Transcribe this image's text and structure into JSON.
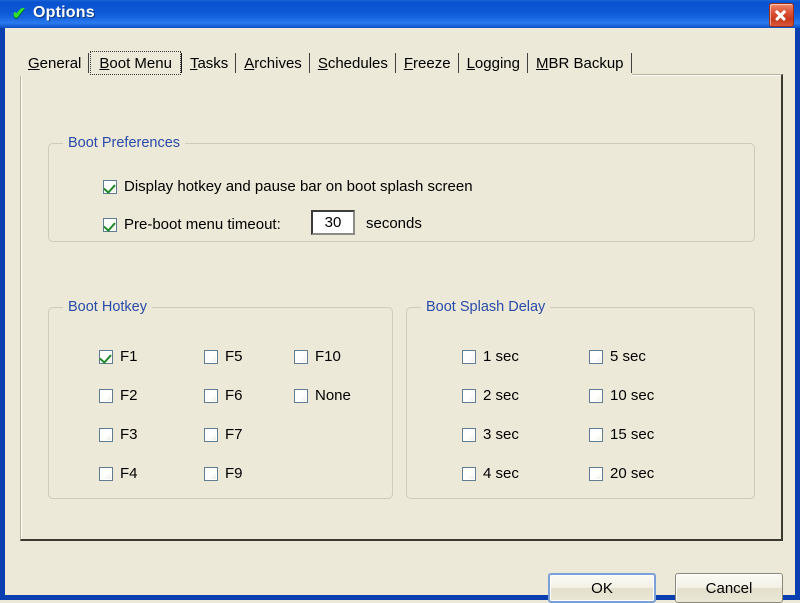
{
  "window": {
    "title": "Options",
    "icon": "green-check-icon",
    "close_label": "✕",
    "accent_blue": "#0a52cf",
    "face_color": "#ece9d8",
    "group_label_color": "#2a4ba8"
  },
  "tabs": [
    {
      "label": "General",
      "accel": "G",
      "active": false
    },
    {
      "label": "Boot Menu",
      "accel": "B",
      "active": true
    },
    {
      "label": "Tasks",
      "accel": "T",
      "active": false
    },
    {
      "label": "Archives",
      "accel": "A",
      "active": false
    },
    {
      "label": "Schedules",
      "accel": "S",
      "active": false
    },
    {
      "label": "Freeze",
      "accel": "F",
      "active": false
    },
    {
      "label": "Logging",
      "accel": "L",
      "active": false
    },
    {
      "label": "MBR Backup",
      "accel": "M",
      "active": false
    }
  ],
  "boot_preferences": {
    "caption": "Boot Preferences",
    "display_hotkey": {
      "label": "Display hotkey and pause bar on boot splash screen",
      "checked": true
    },
    "preboot_timeout": {
      "label": "Pre-boot menu timeout:",
      "checked": true,
      "value": "30",
      "units": "seconds"
    }
  },
  "boot_hotkey": {
    "caption": "Boot Hotkey",
    "options": [
      {
        "label": "F1",
        "checked": true
      },
      {
        "label": "F2",
        "checked": false
      },
      {
        "label": "F3",
        "checked": false
      },
      {
        "label": "F4",
        "checked": false
      },
      {
        "label": "F5",
        "checked": false
      },
      {
        "label": "F6",
        "checked": false
      },
      {
        "label": "F7",
        "checked": false
      },
      {
        "label": "F9",
        "checked": false
      },
      {
        "label": "F10",
        "checked": false
      },
      {
        "label": "None",
        "checked": false
      }
    ]
  },
  "boot_splash_delay": {
    "caption": "Boot Splash Delay",
    "options": [
      {
        "label": "1 sec",
        "checked": false
      },
      {
        "label": "2 sec",
        "checked": false
      },
      {
        "label": "3 sec",
        "checked": false
      },
      {
        "label": "4 sec",
        "checked": false
      },
      {
        "label": "5 sec",
        "checked": false
      },
      {
        "label": "10 sec",
        "checked": false
      },
      {
        "label": "15 sec",
        "checked": false
      },
      {
        "label": "20 sec",
        "checked": false
      }
    ]
  },
  "buttons": {
    "ok": "OK",
    "cancel": "Cancel"
  }
}
